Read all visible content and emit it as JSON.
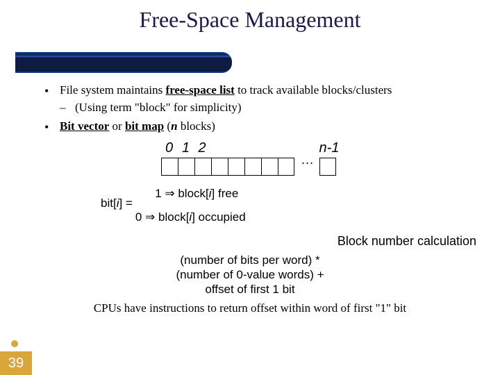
{
  "title": "Free-Space Management",
  "bullets": {
    "b1_pre": "File system maintains ",
    "b1_ul": "free-space list",
    "b1_post": " to track available blocks/clusters",
    "b1_sub": "(Using term \"block\" for simplicity)",
    "b2_a": "Bit vector",
    "b2_mid": " or ",
    "b2_b": "bit map",
    "b2_post1": "  (",
    "b2_n": "n",
    "b2_post2": " blocks)"
  },
  "bitvec": {
    "labels": {
      "l0": "0",
      "l1": "1",
      "l2": "2",
      "ln": "n-1"
    },
    "ellipsis": "…"
  },
  "cases": {
    "lhs_pre": "bit[",
    "lhs_i": "i",
    "lhs_post": "] =",
    "glyph_a": "",
    "glyph_b": "",
    "glyph_c": "",
    "r1_val": "1 ",
    "r1_arrow": "⇒",
    "r1_txt": " block[",
    "r1_i": "i",
    "r1_end": "] free",
    "r2_val": "0 ",
    "r2_arrow": "⇒",
    "r2_txt": " block[",
    "r2_i": "i",
    "r2_end": "] occupied"
  },
  "calc": {
    "heading": "Block number calculation",
    "line1": "(number of bits per word) *",
    "line2": "(number of 0-value words) +",
    "line3": "offset of first 1 bit"
  },
  "footnote": "CPUs have instructions to return offset within word of first \"1\" bit",
  "slide_number": "39"
}
